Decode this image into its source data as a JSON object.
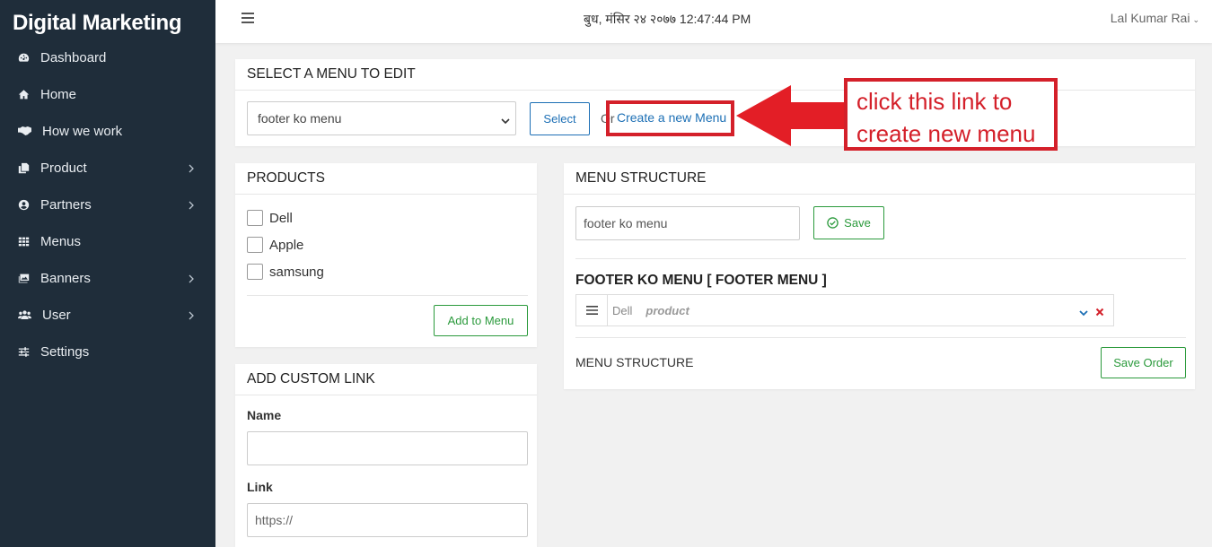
{
  "sidebar": {
    "brand": "Digital Marketing",
    "items": [
      {
        "label": "Dashboard",
        "icon": "dashboard-icon",
        "has_submenu": false
      },
      {
        "label": "Home",
        "icon": "home-icon",
        "has_submenu": false
      },
      {
        "label": "How we work",
        "icon": "handshake-icon",
        "has_submenu": false
      },
      {
        "label": "Product",
        "icon": "copy-icon",
        "has_submenu": true
      },
      {
        "label": "Partners",
        "icon": "user-circle-icon",
        "has_submenu": true
      },
      {
        "label": "Menus",
        "icon": "grid-icon",
        "has_submenu": false
      },
      {
        "label": "Banners",
        "icon": "images-icon",
        "has_submenu": true
      },
      {
        "label": "User",
        "icon": "users-icon",
        "has_submenu": true
      },
      {
        "label": "Settings",
        "icon": "sliders-icon",
        "has_submenu": false
      }
    ]
  },
  "topbar": {
    "datetime": "बुध, मंसिर २४ २०७७ 12:47:44 PM",
    "user_name": "Lal Kumar Rai"
  },
  "select_menu": {
    "title": "SELECT A MENU TO EDIT",
    "selected_option": "footer ko menu",
    "select_button": "Select",
    "or_text": "Or",
    "create_link": "Create a new Menu"
  },
  "products": {
    "title": "PRODUCTS",
    "items": [
      "Dell",
      "Apple",
      "samsung"
    ],
    "add_button": "Add to Menu"
  },
  "custom_link": {
    "title": "ADD CUSTOM LINK",
    "name_label": "Name",
    "name_value": "",
    "link_label": "Link",
    "link_placeholder": "https://"
  },
  "menu_structure": {
    "title": "MENU STRUCTURE",
    "menu_name_value": "footer ko menu",
    "save_button": "Save",
    "menu_heading": "FOOTER KO MENU [ FOOTER MENU ]",
    "items": [
      {
        "name": "Dell",
        "type": "product"
      }
    ],
    "footer_label": "MENU STRUCTURE",
    "save_order_button": "Save Order"
  },
  "annotation": {
    "line1": "click this link to",
    "line2": "create new menu",
    "color": "#d4202a"
  },
  "colors": {
    "sidebar_bg": "#1f2d3a",
    "link_blue": "#1c6fb5",
    "success_green": "#2b9a3c",
    "danger_red": "#d4202a"
  }
}
